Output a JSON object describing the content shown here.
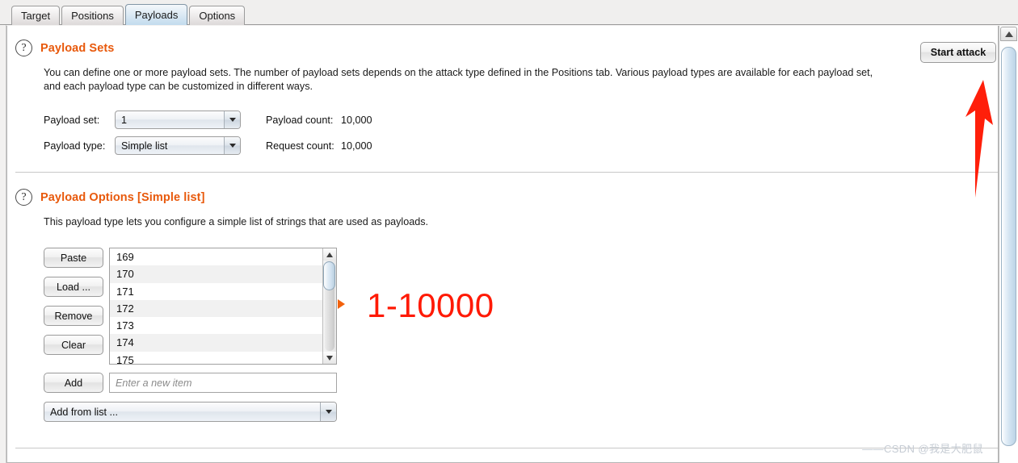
{
  "window": {
    "tabs": [
      {
        "label": "Target",
        "selected": false
      },
      {
        "label": "Positions",
        "selected": false
      },
      {
        "label": "Payloads",
        "selected": true
      },
      {
        "label": "Options",
        "selected": false
      }
    ]
  },
  "toolbar": {
    "start_attack_label": "Start attack"
  },
  "payload_sets": {
    "title": "Payload Sets",
    "help_icon": "question-mark-icon",
    "description_line1": "You can define one or more payload sets. The number of payload sets depends on the attack type defined in the Positions tab. Various payload types are available for each payload set,",
    "description_line2": "and each payload type can be customized in different ways.",
    "payload_set_label": "Payload set:",
    "payload_set_value": "1",
    "payload_type_label": "Payload type:",
    "payload_type_value": "Simple list",
    "payload_count_label": "Payload count:",
    "payload_count_value": "10,000",
    "request_count_label": "Request count:",
    "request_count_value": "10,000"
  },
  "payload_options": {
    "title": "Payload Options [Simple list]",
    "help_icon": "question-mark-icon",
    "description": "This payload type lets you configure a simple list of strings that are used as payloads.",
    "buttons": {
      "paste": "Paste",
      "load": "Load ...",
      "remove": "Remove",
      "clear": "Clear",
      "add": "Add"
    },
    "list_items": [
      "169",
      "170",
      "171",
      "172",
      "173",
      "174",
      "175"
    ],
    "new_item_placeholder": "Enter a new item",
    "new_item_value": "",
    "add_from_list_value": "Add from list ..."
  },
  "annotations": {
    "range_text": "1-10000",
    "range_color": "#ff1a05",
    "arrow_color": "#ff1f0a",
    "marker_color": "#f2610c"
  },
  "watermark": {
    "text": "——CSDN @我是大肥鼠"
  }
}
